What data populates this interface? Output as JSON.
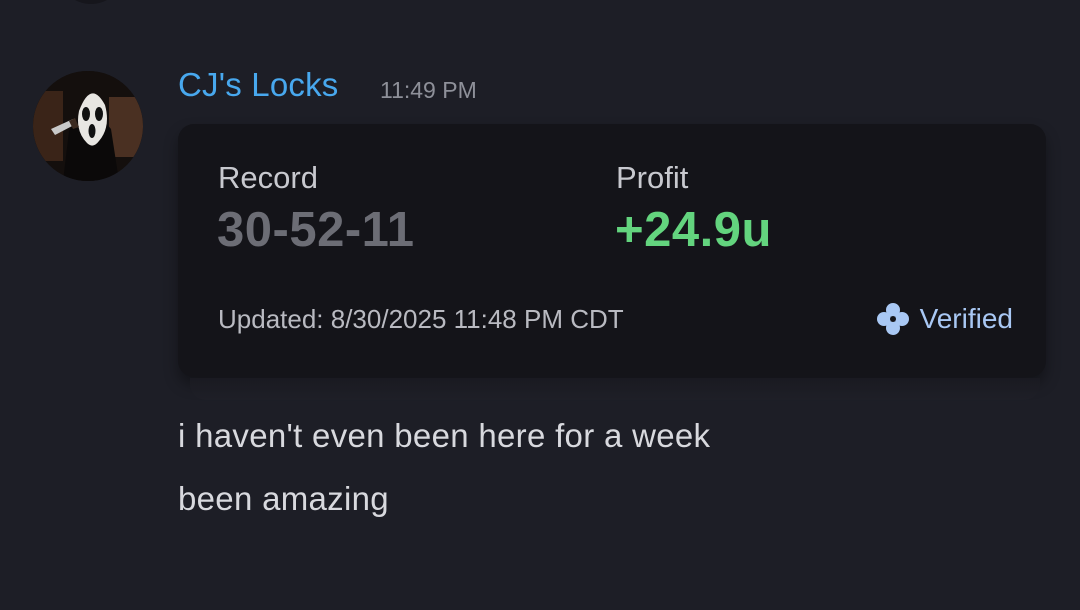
{
  "message": {
    "author": "CJ's Locks",
    "time": "11:49 PM",
    "lines": [
      "i haven't even been here for a week",
      "been amazing"
    ]
  },
  "stats_card": {
    "record_label": "Record",
    "record_value": "30-52-11",
    "profit_label": "Profit",
    "profit_value": "+24.9u",
    "updated_text": "Updated: 8/30/2025 11:48 PM CDT",
    "verified_label": "Verified",
    "verified_icon": "clover-badge-icon"
  },
  "colors": {
    "background": "#1d1e26",
    "username": "#48a8ee",
    "profit_positive": "#63d47e",
    "verified": "#a9c8f4"
  }
}
